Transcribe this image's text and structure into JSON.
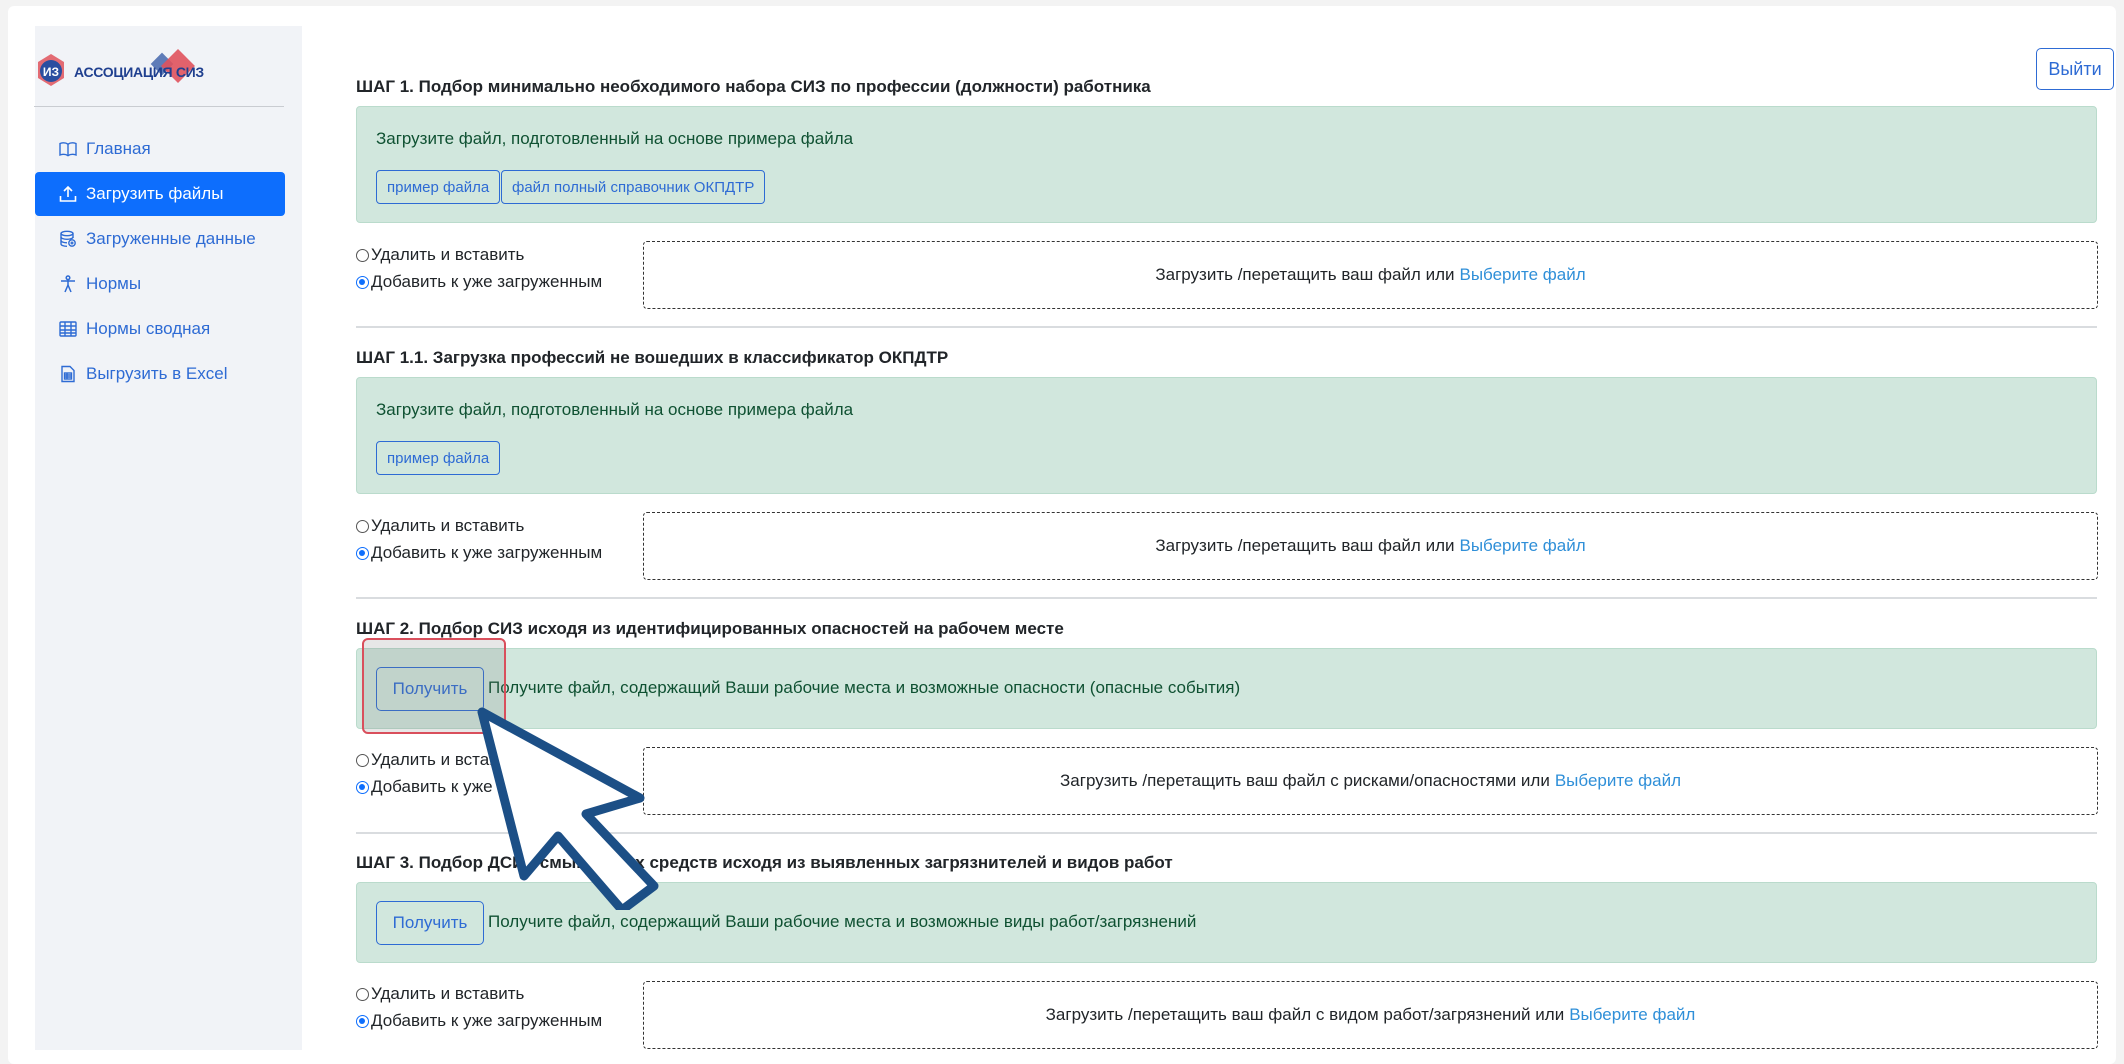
{
  "logo": {
    "text": "АССОЦИАЦИЯ СИЗ"
  },
  "header": {
    "logout_label": "Выйти"
  },
  "sidebar": {
    "items": [
      {
        "label": "Главная",
        "icon": "book-icon",
        "active": false
      },
      {
        "label": "Загрузить файлы",
        "icon": "upload-icon",
        "active": true
      },
      {
        "label": "Загруженные данные",
        "icon": "database-icon",
        "active": false
      },
      {
        "label": "Нормы",
        "icon": "person-icon",
        "active": false
      },
      {
        "label": "Нормы сводная",
        "icon": "table-icon",
        "active": false
      },
      {
        "label": "Выгрузить в Excel",
        "icon": "file-excel-icon",
        "active": false
      }
    ]
  },
  "radio_options": {
    "replace": "Удалить и вставить",
    "append": "Добавить к уже загруженным",
    "selected": "append"
  },
  "steps": [
    {
      "title": "ШАГ 1. Подбор минимально необходимого набора СИЗ по профессии (должности) работника",
      "alert_text": "Загрузите файл, подготовленный на основе примера файла",
      "buttons": [
        "пример файла",
        "файл полный справочник ОКПДТР"
      ],
      "dropzone_text": "Загрузить /перетащить ваш файл или",
      "dropzone_link": "Выберите файл"
    },
    {
      "title": "ШАГ 1.1. Загрузка профессий не вошедших в классификатор ОКПДТР",
      "alert_text": "Загрузите файл, подготовленный на основе примера файла",
      "buttons": [
        "пример файла"
      ],
      "dropzone_text": "Загрузить /перетащить ваш файл или",
      "dropzone_link": "Выберите файл"
    },
    {
      "title": "ШАГ 2. Подбор СИЗ исходя из идентифицированных опасностей на рабочем месте",
      "get_label": "Получить",
      "alert_text": "Получите файл, содержащий Ваши рабочие места и возможные опасности (опасные события)",
      "dropzone_text": "Загрузить /перетащить ваш файл с рисками/опасностями или",
      "dropzone_link": "Выберите файл"
    },
    {
      "title": "ШАГ 3. Подбор ДСИЗ смывающих средств исходя из выявленных загрязнителей и видов работ",
      "get_label": "Получить",
      "alert_text": "Получите файл, содержащий Ваши рабочие места и возможные виды работ/загрязнений",
      "dropzone_text": "Загрузить /перетащить ваш файл с видом работ/загрязнений или",
      "dropzone_link": "Выберите файл"
    }
  ],
  "colors": {
    "primary": "#0d6efd",
    "alert_bg": "#d1e7dd",
    "alert_text": "#0f5132",
    "highlight": "#d94f5c",
    "pointer": "#1c4f86"
  }
}
